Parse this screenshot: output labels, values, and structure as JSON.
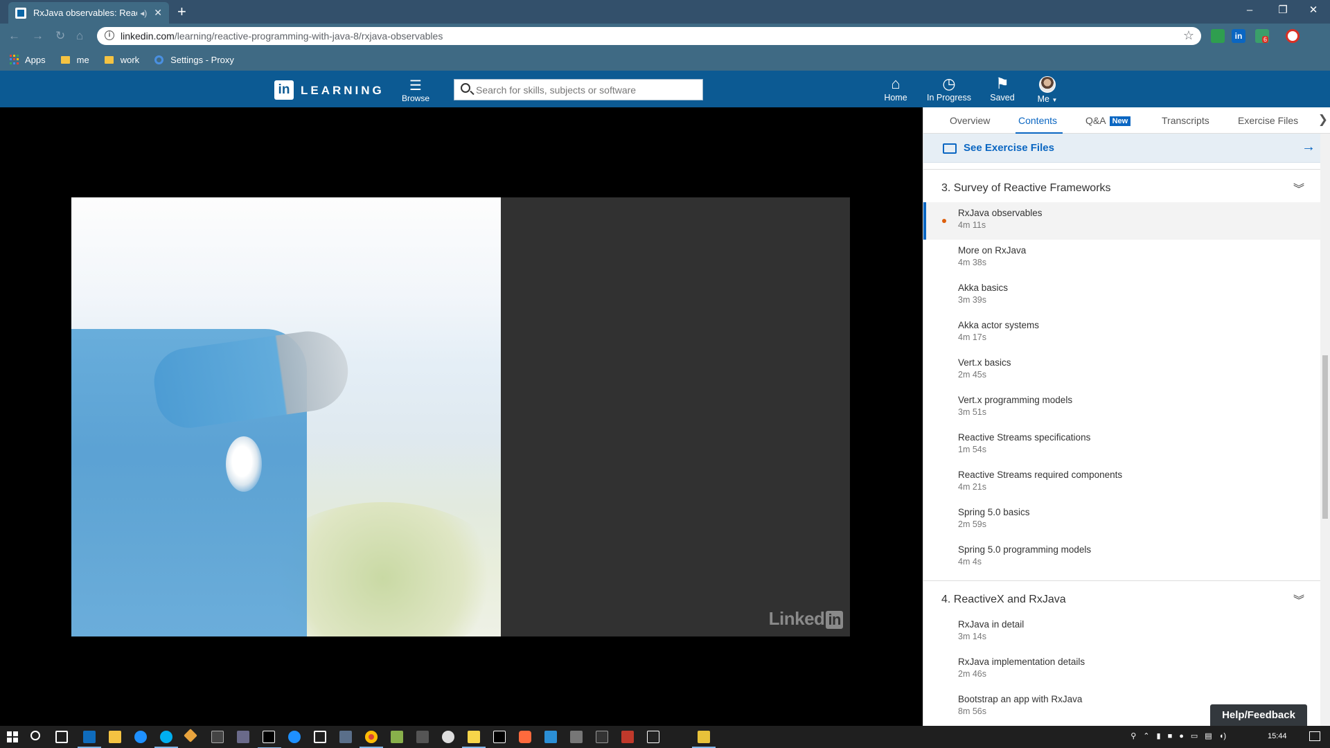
{
  "browser": {
    "tab_title": "RxJava observables: Reactive",
    "url_host": "linkedin.com",
    "url_path": "/learning/reactive-programming-with-java-8/rxjava-observables",
    "bookmarks": [
      {
        "label": "Apps",
        "icon": "apps-grid-icon"
      },
      {
        "label": "me",
        "icon": "folder-icon"
      },
      {
        "label": "work",
        "icon": "folder-icon"
      },
      {
        "label": "Settings - Proxy",
        "icon": "gear-icon"
      }
    ],
    "extension_badge": "6"
  },
  "header": {
    "logo": "in",
    "wordmark": "LEARNING",
    "browse_label": "Browse",
    "search_placeholder": "Search for skills, subjects or software",
    "nav": [
      {
        "label": "Home",
        "icon": "home-icon"
      },
      {
        "label": "In Progress",
        "icon": "clock-icon"
      },
      {
        "label": "Saved",
        "icon": "bookmark-icon"
      },
      {
        "label": "Me",
        "icon": "avatar"
      }
    ]
  },
  "video": {
    "watermark": "Linked",
    "watermark_in": "in"
  },
  "panel": {
    "tabs": [
      "Overview",
      "Contents",
      "Q&A",
      "Transcripts",
      "Exercise Files"
    ],
    "active_tab": "Contents",
    "new_badge": "New",
    "exercise_files_label": "See Exercise Files",
    "chapters": [
      {
        "title": "3. Survey of Reactive Frameworks",
        "items": [
          {
            "title": "RxJava observables",
            "duration": "4m 11s",
            "active": true
          },
          {
            "title": "More on RxJava",
            "duration": "4m 38s"
          },
          {
            "title": "Akka basics",
            "duration": "3m 39s"
          },
          {
            "title": "Akka actor systems",
            "duration": "4m 17s"
          },
          {
            "title": "Vert.x basics",
            "duration": "2m 45s"
          },
          {
            "title": "Vert.x programming models",
            "duration": "3m 51s"
          },
          {
            "title": "Reactive Streams specifications",
            "duration": "1m 54s"
          },
          {
            "title": "Reactive Streams required components",
            "duration": "4m 21s"
          },
          {
            "title": "Spring 5.0 basics",
            "duration": "2m 59s"
          },
          {
            "title": "Spring 5.0 programming models",
            "duration": "4m 4s"
          }
        ]
      },
      {
        "title": "4. ReactiveX and RxJava",
        "items": [
          {
            "title": "RxJava in detail",
            "duration": "3m 14s"
          },
          {
            "title": "RxJava implementation details",
            "duration": "2m 46s"
          },
          {
            "title": "Bootstrap an app with RxJava",
            "duration": "8m 56s"
          }
        ]
      }
    ],
    "help_feedback": "Help/Feedback"
  },
  "taskbar": {
    "clock": "15:44"
  }
}
